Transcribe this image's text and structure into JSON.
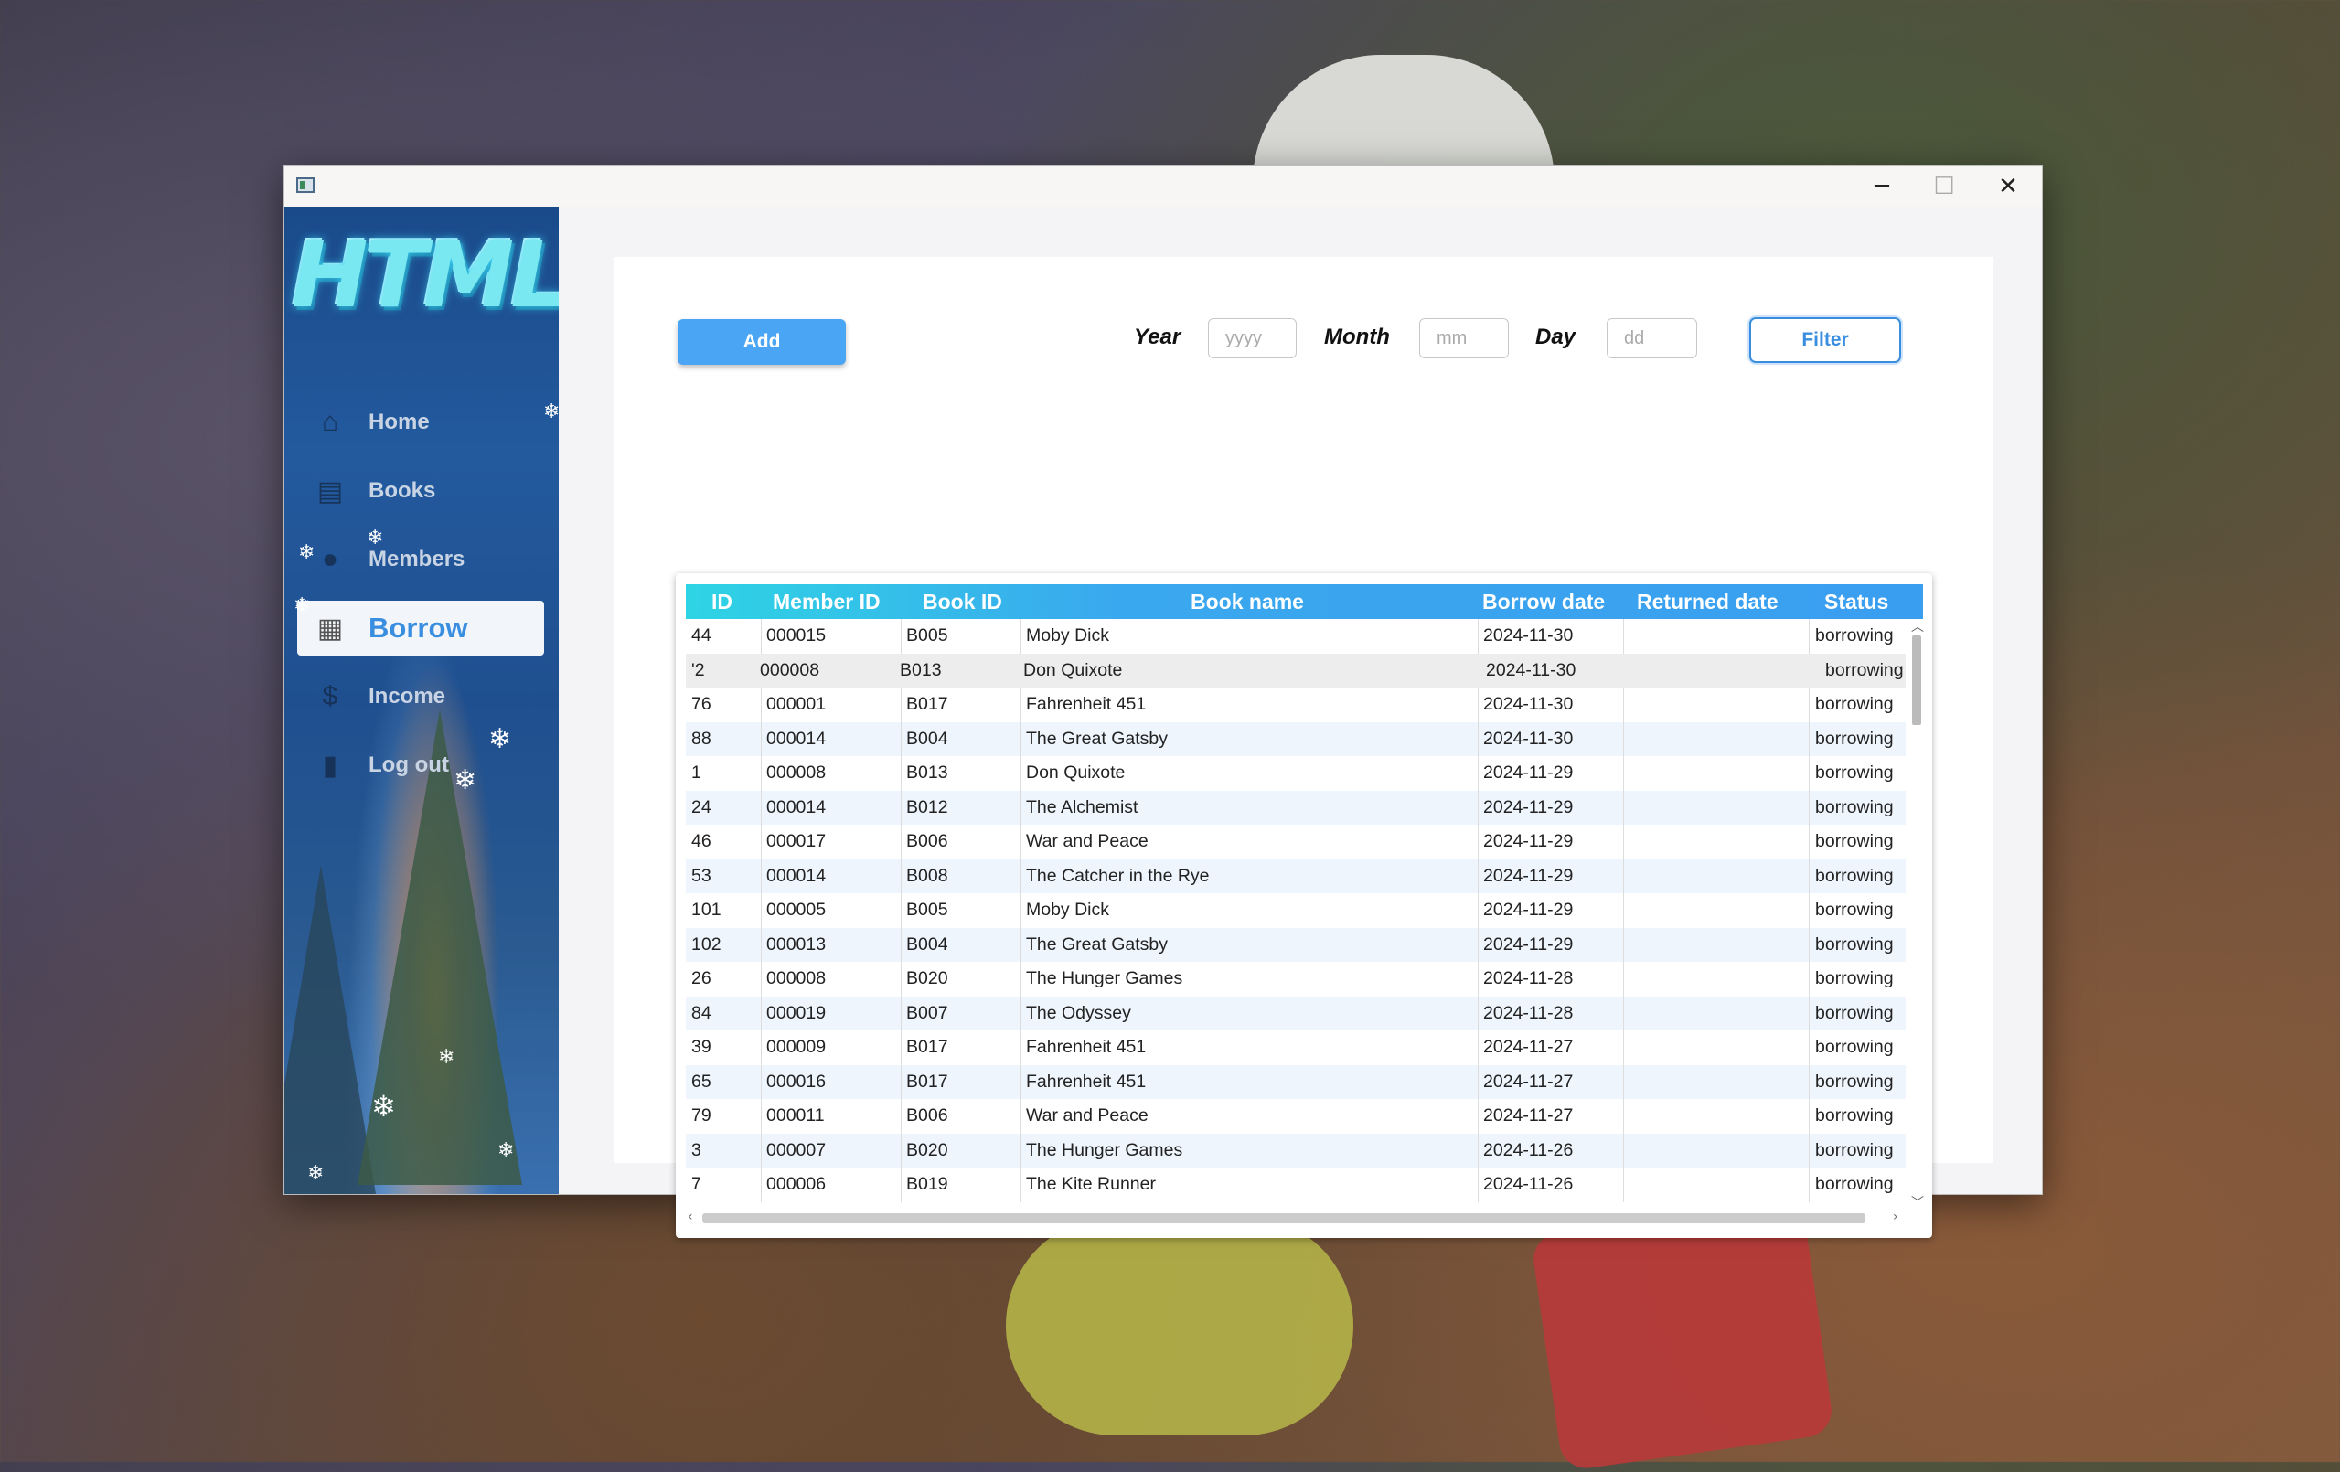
{
  "window": {
    "minimize": "─",
    "maximize": "☐",
    "close": "✕"
  },
  "sidebar": {
    "logo": "HTML",
    "items": [
      {
        "label": "Home",
        "icon": "home-icon",
        "glyph": "⌂"
      },
      {
        "label": "Books",
        "icon": "books-icon",
        "glyph": "▤"
      },
      {
        "label": "Members",
        "icon": "members-icon",
        "glyph": "●"
      },
      {
        "label": "Borrow",
        "icon": "borrow-icon",
        "glyph": "▦"
      },
      {
        "label": "Income",
        "icon": "income-icon",
        "glyph": "$"
      },
      {
        "label": "Log out",
        "icon": "logout-icon",
        "glyph": "▮"
      }
    ],
    "active": "Borrow"
  },
  "toolbar": {
    "add_label": "Add",
    "year_label": "Year",
    "year_placeholder": "yyyy",
    "month_label": "Month",
    "month_placeholder": "mm",
    "day_label": "Day",
    "day_placeholder": "dd",
    "filter_label": "Filter"
  },
  "table": {
    "columns": [
      "ID",
      "Member ID",
      "Book ID",
      "Book name",
      "Borrow date",
      "Returned date",
      "Status"
    ],
    "rows": [
      [
        "44",
        "000015",
        "B005",
        "Moby Dick",
        "2024-11-30",
        "",
        "borrowing"
      ],
      [
        "'2",
        "000008",
        "B013",
        "Don Quixote",
        "2024-11-30",
        "",
        "borrowing"
      ],
      [
        "76",
        "000001",
        "B017",
        "Fahrenheit 451",
        "2024-11-30",
        "",
        "borrowing"
      ],
      [
        "88",
        "000014",
        "B004",
        "The Great Gatsby",
        "2024-11-30",
        "",
        "borrowing"
      ],
      [
        "1",
        "000008",
        "B013",
        "Don Quixote",
        "2024-11-29",
        "",
        "borrowing"
      ],
      [
        "24",
        "000014",
        "B012",
        "The Alchemist",
        "2024-11-29",
        "",
        "borrowing"
      ],
      [
        "46",
        "000017",
        "B006",
        "War and Peace",
        "2024-11-29",
        "",
        "borrowing"
      ],
      [
        "53",
        "000014",
        "B008",
        "The Catcher in the Rye",
        "2024-11-29",
        "",
        "borrowing"
      ],
      [
        "101",
        "000005",
        "B005",
        "Moby Dick",
        "2024-11-29",
        "",
        "borrowing"
      ],
      [
        "102",
        "000013",
        "B004",
        "The Great Gatsby",
        "2024-11-29",
        "",
        "borrowing"
      ],
      [
        "26",
        "000008",
        "B020",
        "The Hunger Games",
        "2024-11-28",
        "",
        "borrowing"
      ],
      [
        "84",
        "000019",
        "B007",
        "The Odyssey",
        "2024-11-28",
        "",
        "borrowing"
      ],
      [
        "39",
        "000009",
        "B017",
        "Fahrenheit 451",
        "2024-11-27",
        "",
        "borrowing"
      ],
      [
        "65",
        "000016",
        "B017",
        "Fahrenheit 451",
        "2024-11-27",
        "",
        "borrowing"
      ],
      [
        "79",
        "000011",
        "B006",
        "War and Peace",
        "2024-11-27",
        "",
        "borrowing"
      ],
      [
        "3",
        "000007",
        "B020",
        "The Hunger Games",
        "2024-11-26",
        "",
        "borrowing"
      ],
      [
        "7",
        "000006",
        "B019",
        "The Kite Runner",
        "2024-11-26",
        "",
        "borrowing"
      ]
    ]
  },
  "colors": {
    "accent": "#3a8ee0",
    "add_button": "#4aa6f4",
    "header_gradient_start": "#2ed4e4",
    "header_gradient_end": "#3a9ef0",
    "row_alt": "#eef5fd"
  }
}
